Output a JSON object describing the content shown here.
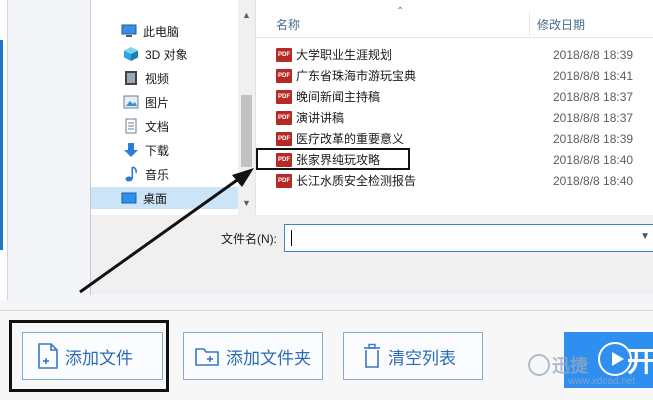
{
  "nav": {
    "items": [
      {
        "label": "此电脑",
        "icon": "computer-icon"
      },
      {
        "label": "3D 对象",
        "icon": "cube-icon"
      },
      {
        "label": "视频",
        "icon": "video-icon"
      },
      {
        "label": "图片",
        "icon": "picture-icon"
      },
      {
        "label": "文档",
        "icon": "document-icon"
      },
      {
        "label": "下载",
        "icon": "download-icon"
      },
      {
        "label": "音乐",
        "icon": "music-icon"
      },
      {
        "label": "桌面",
        "icon": "desktop-icon",
        "selected": true
      }
    ]
  },
  "file_list": {
    "columns": {
      "name": "名称",
      "modified": "修改日期"
    },
    "file_icon_label": "PDF",
    "files": [
      {
        "name": "大学职业生涯规划",
        "date": "2018/8/8 18:39"
      },
      {
        "name": "广东省珠海市游玩宝典",
        "date": "2018/8/8 18:41"
      },
      {
        "name": "晚间新闻主持稿",
        "date": "2018/8/8 18:37"
      },
      {
        "name": "演讲讲稿",
        "date": "2018/8/8 18:37"
      },
      {
        "name": "医疗改革的重要意义",
        "date": "2018/8/8 18:39"
      },
      {
        "name": "张家界纯玩攻略",
        "date": "2018/8/8 18:40"
      },
      {
        "name": "长江水质安全检测报告",
        "date": "2018/8/8 18:40"
      }
    ]
  },
  "filename": {
    "label": "文件名(N):",
    "value": ""
  },
  "toolbar": {
    "add_file": "添加文件",
    "add_folder": "添加文件夹",
    "clear_list": "清空列表",
    "start_partial": "开"
  },
  "watermark": {
    "text": "迅捷",
    "url": "www.xdcad.net"
  },
  "colors": {
    "accent": "#2f8ff0",
    "pdf": "#b52a25",
    "selection": "#cce4f7"
  }
}
